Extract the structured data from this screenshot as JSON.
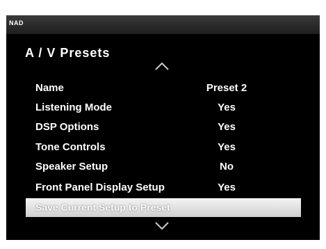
{
  "header": {
    "logo": "NAD"
  },
  "page": {
    "title": "A / V  Presets"
  },
  "icons": {
    "scroll_up": "chevron-up-icon",
    "scroll_down": "chevron-down-icon"
  },
  "menu": {
    "rows": [
      {
        "label": "Name",
        "value": "Preset 2"
      },
      {
        "label": "Listening Mode",
        "value": "Yes"
      },
      {
        "label": "DSP Options",
        "value": "Yes"
      },
      {
        "label": "Tone Controls",
        "value": "Yes"
      },
      {
        "label": "Speaker Setup",
        "value": "No"
      },
      {
        "label": "Front Panel Display Setup",
        "value": "Yes"
      }
    ],
    "action": {
      "label": "Save Current Setup to Preset"
    }
  },
  "colors": {
    "screen_bg": "#000000",
    "text": "#ffffff",
    "highlight": "#e6e6e6"
  }
}
